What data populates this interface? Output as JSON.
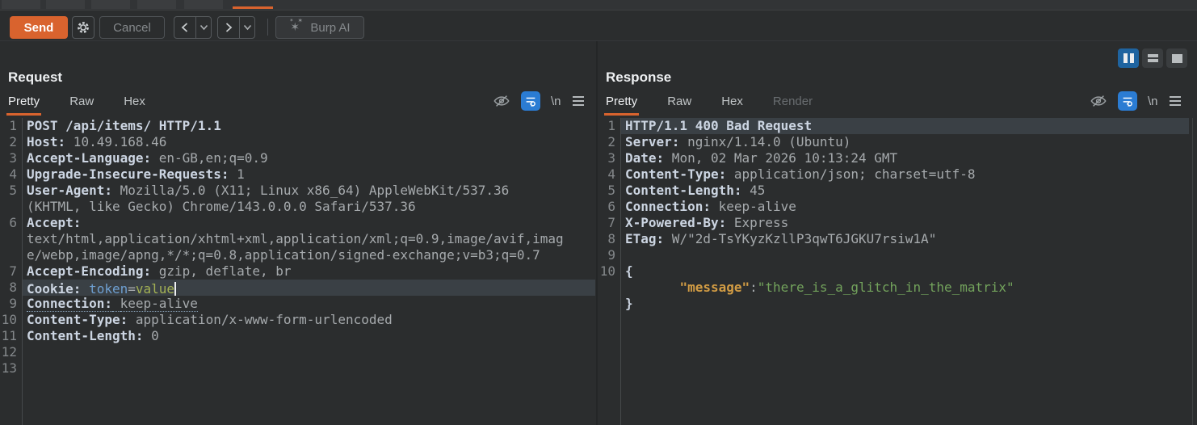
{
  "toolbar": {
    "send": "Send",
    "cancel": "Cancel",
    "burp_ai": "Burp AI"
  },
  "request": {
    "title": "Request",
    "tabs": [
      {
        "label": "Pretty",
        "state": "active"
      },
      {
        "label": "Raw",
        "state": "normal"
      },
      {
        "label": "Hex",
        "state": "normal"
      }
    ],
    "newline_toggle": "\\n",
    "rows": [
      {
        "n": "1",
        "s": [
          {
            "t": "POST /api/items/ HTTP/1.1",
            "c": "hdr"
          }
        ]
      },
      {
        "n": "2",
        "s": [
          {
            "t": "Host:",
            "c": "hdr"
          },
          {
            "t": " 10.49.168.46",
            "c": "val"
          }
        ]
      },
      {
        "n": "3",
        "s": [
          {
            "t": "Accept-Language:",
            "c": "hdr"
          },
          {
            "t": " en-GB,en;q=0.9",
            "c": "val"
          }
        ]
      },
      {
        "n": "4",
        "s": [
          {
            "t": "Upgrade-Insecure-Requests:",
            "c": "hdr"
          },
          {
            "t": " 1",
            "c": "val"
          }
        ]
      },
      {
        "n": "5",
        "s": [
          {
            "t": "User-Agent:",
            "c": "hdr"
          },
          {
            "t": " Mozilla/5.0 (X11; Linux x86_64) AppleWebKit/537.36",
            "c": "val"
          }
        ]
      },
      {
        "n": "",
        "s": [
          {
            "t": "(KHTML, like Gecko) Chrome/143.0.0.0 Safari/537.36",
            "c": "val"
          }
        ]
      },
      {
        "n": "6",
        "s": [
          {
            "t": "Accept:",
            "c": "hdr"
          }
        ]
      },
      {
        "n": "",
        "s": [
          {
            "t": "text/html,application/xhtml+xml,application/xml;q=0.9,image/avif,imag",
            "c": "val"
          }
        ]
      },
      {
        "n": "",
        "s": [
          {
            "t": "e/webp,image/apng,*/*;q=0.8,application/signed-exchange;v=b3;q=0.7",
            "c": "val"
          }
        ]
      },
      {
        "n": "7",
        "s": [
          {
            "t": "Accept-Encoding:",
            "c": "hdr"
          },
          {
            "t": " gzip, deflate, br",
            "c": "val"
          }
        ]
      },
      {
        "n": "8",
        "hl": true,
        "caret": true,
        "s": [
          {
            "t": "Cookie:",
            "c": "hdr"
          },
          {
            "t": " ",
            "c": "val"
          },
          {
            "t": "token",
            "c": "tok"
          },
          {
            "t": "=",
            "c": "val"
          },
          {
            "t": "value",
            "c": "grn"
          }
        ]
      },
      {
        "n": "9",
        "s": [
          {
            "t": "Connection:",
            "c": "hdr",
            "u": true
          },
          {
            "t": " ",
            "c": "val",
            "u": true
          },
          {
            "t": "keep-alive",
            "c": "val",
            "u": true
          }
        ]
      },
      {
        "n": "10",
        "s": [
          {
            "t": "Content-Type:",
            "c": "hdr"
          },
          {
            "t": " application/x-www-form-urlencoded",
            "c": "val"
          }
        ]
      },
      {
        "n": "11",
        "s": [
          {
            "t": "Content-Length:",
            "c": "hdr"
          },
          {
            "t": " 0",
            "c": "val"
          }
        ]
      },
      {
        "n": "12",
        "s": []
      },
      {
        "n": "13",
        "s": []
      }
    ]
  },
  "response": {
    "title": "Response",
    "tabs": [
      {
        "label": "Pretty",
        "state": "active"
      },
      {
        "label": "Raw",
        "state": "normal"
      },
      {
        "label": "Hex",
        "state": "normal"
      },
      {
        "label": "Render",
        "state": "disabled"
      }
    ],
    "newline_toggle": "\\n",
    "rows": [
      {
        "n": "1",
        "hl": true,
        "s": [
          {
            "t": "HTTP/1.1 400 Bad Request",
            "c": "hdr"
          }
        ]
      },
      {
        "n": "2",
        "s": [
          {
            "t": "Server:",
            "c": "hdr"
          },
          {
            "t": " nginx/1.14.0 (Ubuntu)",
            "c": "val"
          }
        ]
      },
      {
        "n": "3",
        "s": [
          {
            "t": "Date:",
            "c": "hdr"
          },
          {
            "t": " Mon, 02 Mar 2026 10:13:24 GMT",
            "c": "val"
          }
        ]
      },
      {
        "n": "4",
        "s": [
          {
            "t": "Content-Type:",
            "c": "hdr"
          },
          {
            "t": " application/json; charset=utf-8",
            "c": "val"
          }
        ]
      },
      {
        "n": "5",
        "s": [
          {
            "t": "Content-Length:",
            "c": "hdr"
          },
          {
            "t": " 45",
            "c": "val"
          }
        ]
      },
      {
        "n": "6",
        "s": [
          {
            "t": "Connection:",
            "c": "hdr"
          },
          {
            "t": " keep-alive",
            "c": "val"
          }
        ]
      },
      {
        "n": "7",
        "s": [
          {
            "t": "X-Powered-By:",
            "c": "hdr"
          },
          {
            "t": " Express",
            "c": "val"
          }
        ]
      },
      {
        "n": "8",
        "s": [
          {
            "t": "ETag:",
            "c": "hdr"
          },
          {
            "t": " W/\"2d-TsYKyzKzllP3qwT6JGKU7rsiw1A\"",
            "c": "val"
          }
        ]
      },
      {
        "n": "9",
        "s": []
      },
      {
        "n": "10",
        "s": [
          {
            "t": "{",
            "c": "hdr"
          }
        ]
      },
      {
        "n": "",
        "s": [
          {
            "t": "       ",
            "c": "val"
          },
          {
            "t": "\"message\"",
            "c": "key"
          },
          {
            "t": ":",
            "c": "val"
          },
          {
            "t": "\"there_is_a_glitch_in_the_matrix\"",
            "c": "str"
          }
        ]
      },
      {
        "n": "",
        "s": [
          {
            "t": "}",
            "c": "hdr"
          }
        ]
      }
    ]
  },
  "colors": {
    "accent_orange": "#d9632e",
    "wrap_active_blue": "#2b7cd3",
    "layout_selected_blue": "#1f64a0",
    "line_highlight": "#3a4045"
  }
}
